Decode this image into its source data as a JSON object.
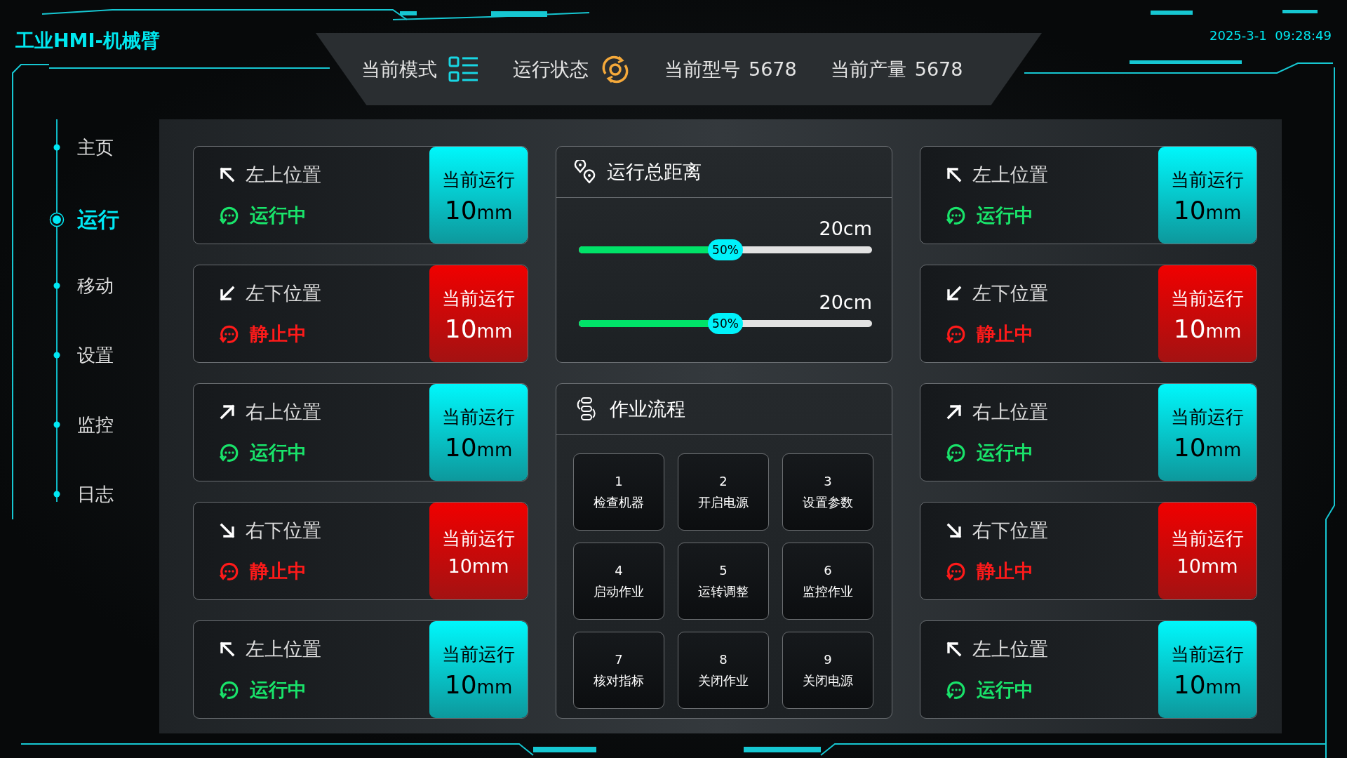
{
  "app": {
    "title": "工业HMI-机械臂",
    "datetime": "2025-3-1  09:28:49"
  },
  "header": [
    {
      "kind": "mode",
      "label": "当前模式"
    },
    {
      "kind": "status",
      "label": "运行状态"
    },
    {
      "kind": "value",
      "label": "当前型号",
      "value": "5678"
    },
    {
      "kind": "value",
      "label": "当前产量",
      "value": "5678"
    }
  ],
  "nav": [
    {
      "label": "主页",
      "selected": false
    },
    {
      "label": "运行",
      "selected": true
    },
    {
      "label": "移动",
      "selected": false
    },
    {
      "label": "设置",
      "selected": false
    },
    {
      "label": "监控",
      "selected": false
    },
    {
      "label": "日志",
      "selected": false
    }
  ],
  "left_cards": [
    {
      "label": "左上位置",
      "pointing_up": true,
      "pointing_left": true,
      "status": "运行中",
      "running": true,
      "box_title": "当前运行",
      "value": "10",
      "unit": "mm"
    },
    {
      "label": "左下位置",
      "pointing_up": false,
      "pointing_left": true,
      "status": "静止中",
      "running": false,
      "box_title": "当前运行",
      "value": "10",
      "unit": "mm"
    },
    {
      "label": "右上位置",
      "pointing_up": true,
      "pointing_left": false,
      "status": "运行中",
      "running": true,
      "box_title": "当前运行",
      "value": "10",
      "unit": "mm"
    },
    {
      "label": "右下位置",
      "pointing_up": false,
      "pointing_left": false,
      "status": "静止中",
      "running": false,
      "box_title": "当前运行",
      "value": "10mm"
    },
    {
      "label": "左上位置",
      "pointing_up": true,
      "pointing_left": true,
      "status": "运行中",
      "running": true,
      "box_title": "当前运行",
      "value": "10",
      "unit": "mm"
    }
  ],
  "distance_panel": {
    "title": "运行总距离",
    "sliders": [
      {
        "reading": "20cm",
        "level": 0.5,
        "thumb": "50%"
      },
      {
        "reading": "20cm",
        "level": 0.5,
        "thumb": "50%"
      }
    ]
  },
  "flow_panel": {
    "title": "作业流程",
    "steps": [
      {
        "number": "1",
        "label": "检查机器"
      },
      {
        "number": "2",
        "label": "开启电源"
      },
      {
        "number": "3",
        "label": "设置参数"
      },
      {
        "number": "4",
        "label": "启动作业"
      },
      {
        "number": "5",
        "label": "运转调整"
      },
      {
        "number": "6",
        "label": "监控作业"
      },
      {
        "number": "7",
        "label": "核对指标"
      },
      {
        "number": "8",
        "label": "关闭作业"
      },
      {
        "number": "9",
        "label": "关闭电源"
      }
    ]
  },
  "right_cards": [
    {
      "label": "左上位置",
      "pointing_up": true,
      "pointing_left": true,
      "status": "运行中",
      "running": true,
      "box_title": "当前运行",
      "value": "10",
      "unit": "mm"
    },
    {
      "label": "左下位置",
      "pointing_up": false,
      "pointing_left": true,
      "status": "静止中",
      "running": false,
      "box_title": "当前运行",
      "value": "10",
      "unit": "mm"
    },
    {
      "label": "右上位置",
      "pointing_up": true,
      "pointing_left": false,
      "status": "运行中",
      "running": true,
      "box_title": "当前运行",
      "value": "10",
      "unit": "mm"
    },
    {
      "label": "右下位置",
      "pointing_up": false,
      "pointing_left": false,
      "status": "静止中",
      "running": false,
      "box_title": "当前运行",
      "value": "10mm"
    },
    {
      "label": "左上位置",
      "pointing_up": true,
      "pointing_left": true,
      "status": "运行中",
      "running": true,
      "box_title": "当前运行",
      "value": "10",
      "unit": "mm"
    }
  ]
}
